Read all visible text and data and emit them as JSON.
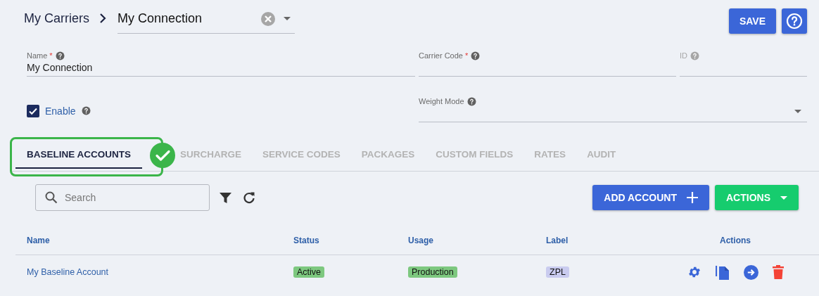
{
  "breadcrumb": {
    "parent": "My Carriers",
    "connection_select": {
      "value": "My Connection"
    }
  },
  "header_buttons": {
    "save": "SAVE"
  },
  "fields": [
    {
      "label": "Name",
      "required_mark": "*",
      "disabled": false,
      "value": "My Connection"
    },
    {
      "label": "Carrier Code",
      "required_mark": "*",
      "disabled": false
    },
    {
      "label": "ID",
      "disabled": true
    }
  ],
  "enable": {
    "label": "Enable",
    "checked": true
  },
  "weight_mode": {
    "label": "Weight Mode"
  },
  "tabs": [
    {
      "label": "BASELINE ACCOUNTS",
      "selected": true,
      "highlighted": true
    },
    {
      "label": "SURCHARGE",
      "selected": false,
      "highlighted": false
    },
    {
      "label": "SERVICE CODES",
      "selected": false,
      "highlighted": false
    },
    {
      "label": "PACKAGES",
      "selected": false,
      "highlighted": false
    },
    {
      "label": "CUSTOM FIELDS",
      "selected": false,
      "highlighted": false
    },
    {
      "label": "RATES",
      "selected": false,
      "highlighted": false
    },
    {
      "label": "AUDIT",
      "selected": false,
      "highlighted": false
    }
  ],
  "search": {
    "placeholder": "Search"
  },
  "buttons": [
    {
      "label": "ADD ACCOUNT",
      "kind": "add"
    },
    {
      "label": "ACTIONS",
      "kind": "menu"
    }
  ],
  "table": {
    "columns": [
      "Name",
      "Status",
      "Usage",
      "Label",
      "Actions"
    ],
    "rows": [
      {
        "name": "My Baseline Account",
        "status": {
          "text": "Active",
          "color": "#7dc87f"
        },
        "usage": {
          "text": "Production",
          "color": "#7dc87f"
        },
        "label": {
          "text": "ZPL",
          "color": "#c9cbef"
        }
      }
    ]
  }
}
